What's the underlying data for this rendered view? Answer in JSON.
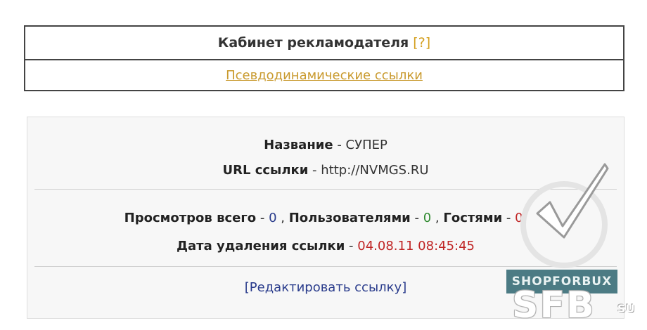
{
  "header": {
    "title": "Кабинет рекламодателя",
    "help": "[?]",
    "link": "Псевдодинамические ссылки"
  },
  "info": {
    "name_label": "Название",
    "name_value": "СУПЕР",
    "url_label": "URL ссылки",
    "url_value": "http://NVMGS.RU",
    "views_total_label": "Просмотров всего",
    "views_total_value": "0",
    "users_label": "Пользователями",
    "users_value": "0",
    "guests_label": "Гостями",
    "guests_value": "0.",
    "delete_date_label": "Дата удаления ссылки",
    "delete_date_value": "04.08.11 08:45:45",
    "edit_link": "[Редактировать ссылку]",
    "dash": " - ",
    "comma": " , "
  },
  "watermark": {
    "banner": "SHOPFORBUX",
    "logo": "SFB",
    "logo_suffix": "SU"
  },
  "colors": {
    "help_link": "#d4a020",
    "pseudo_link": "#c99a2e",
    "value_blue": "#2a3c8c",
    "value_green": "#2f8a2f",
    "value_red": "#c02525",
    "border": "#444444"
  }
}
